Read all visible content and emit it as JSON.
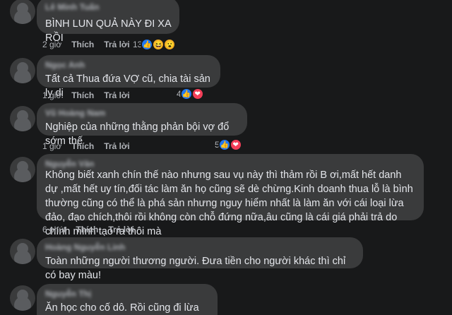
{
  "actions": {
    "like": "Thích",
    "reply": "Trả lời"
  },
  "comments": [
    {
      "author": "Lê Minh Tuấn",
      "text": "BÌNH LUN QUẢ NÀY ĐI XA RỒI",
      "time": "2 giờ",
      "react_count": "13",
      "reactions": [
        "like",
        "haha",
        "wow"
      ]
    },
    {
      "author": "Ngọc Anh",
      "text": "Tất cả Thua đứa VỢ cũ, chia tài sản ly dị",
      "time": "1 giờ",
      "react_count": "4",
      "reactions": [
        "like",
        "love"
      ]
    },
    {
      "author": "Vũ Hoàng Nam",
      "text": "Nghiệp của những thằng phản bội vợ đổ sớm thế",
      "time": "1 giờ",
      "react_count": "5",
      "reactions": [
        "like",
        "love"
      ]
    },
    {
      "author": "Nguyễn Văn",
      "text": "Không biết xanh chín thế nào nhưng sau vụ này thì thảm rồi B ơi,mất hết danh dự ,mất hết uy tín,đối tác làm ăn họ cũng sẽ dè chừng.Kinh doanh thua lỗ là bình thường cũng có thể là phá sản nhưng nguy hiểm nhất là làm ăn với cái loại lừa đảo, đạo chích,thôi rồi không còn chỗ đứng nữa,âu cũng là cái giá phải trả do chính mình tạo ra thôi mà",
      "time": "6 phút",
      "react_count": "",
      "reactions": []
    },
    {
      "author": "Hoàng Nguyễn Linh",
      "text": "Toàn những người thương người. Đưa tiền cho người khác thì chỉ có bay màu!",
      "time": "",
      "react_count": "",
      "reactions": []
    },
    {
      "author": "Nguyễn Thị",
      "text": "Ăn học cho cố dô. Rồi cũng đi lừa đảo hết. Giỏi",
      "time": "",
      "react_count": "",
      "reactions": []
    }
  ]
}
